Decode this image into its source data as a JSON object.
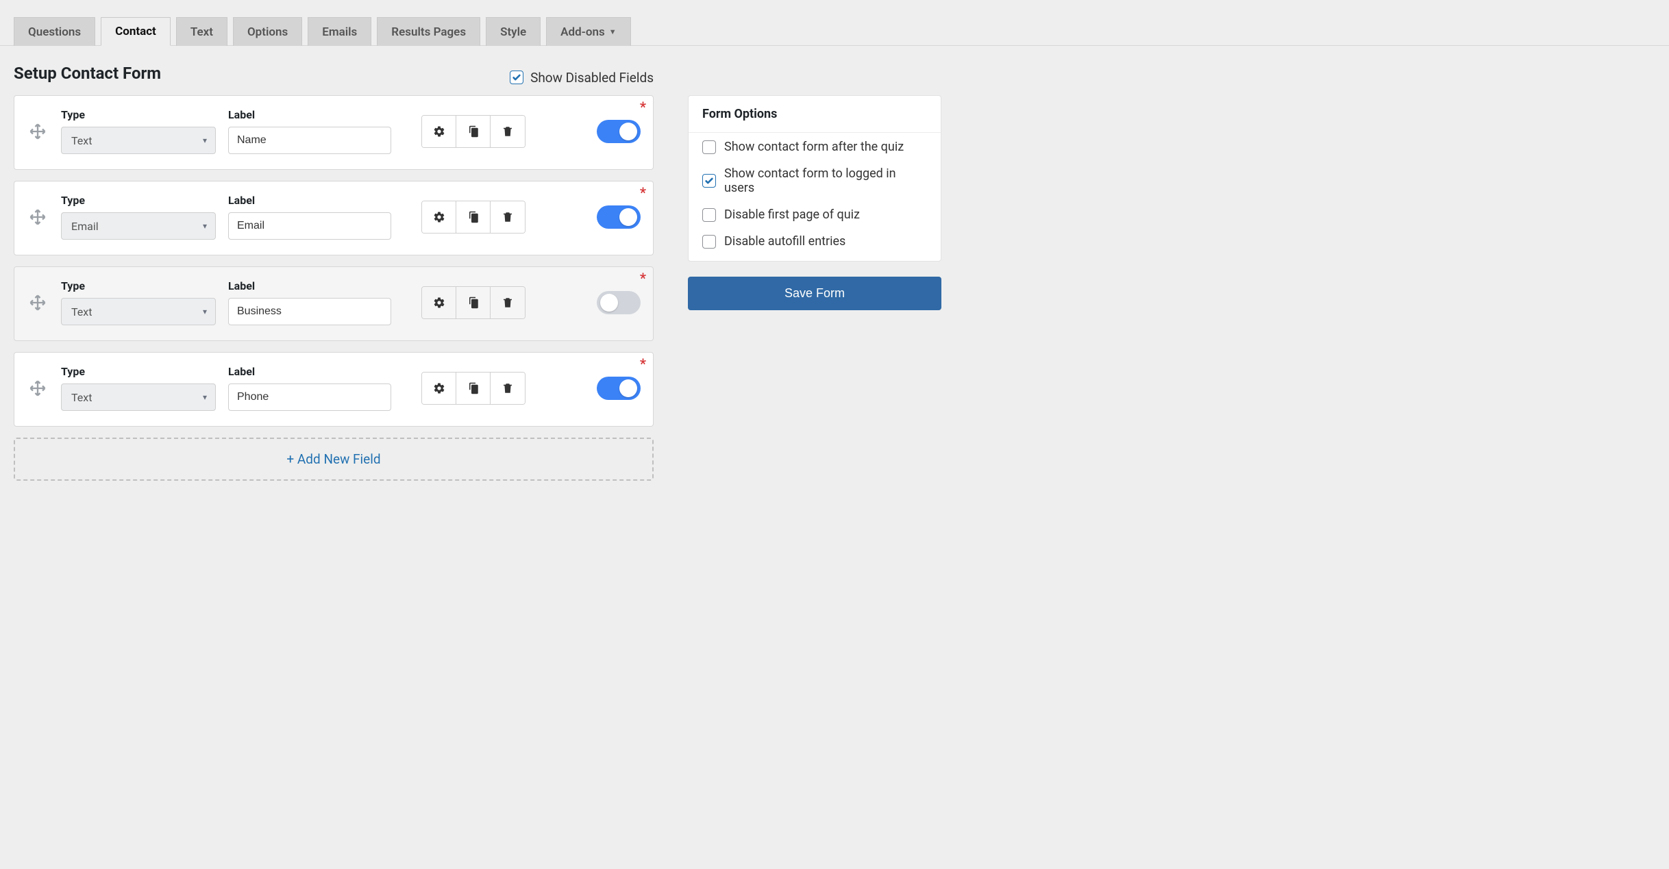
{
  "tabs": [
    {
      "label": "Questions"
    },
    {
      "label": "Contact"
    },
    {
      "label": "Text"
    },
    {
      "label": "Options"
    },
    {
      "label": "Emails"
    },
    {
      "label": "Results Pages"
    },
    {
      "label": "Style"
    },
    {
      "label": "Add-ons"
    }
  ],
  "active_tab_index": 1,
  "heading": "Setup Contact Form",
  "show_disabled_label": "Show Disabled Fields",
  "show_disabled_checked": true,
  "columns": {
    "type": "Type",
    "label": "Label"
  },
  "fields": [
    {
      "type": "Text",
      "label": "Name",
      "enabled": true,
      "required": true
    },
    {
      "type": "Email",
      "label": "Email",
      "enabled": true,
      "required": true
    },
    {
      "type": "Text",
      "label": "Business",
      "enabled": false,
      "required": true
    },
    {
      "type": "Text",
      "label": "Phone",
      "enabled": true,
      "required": true
    }
  ],
  "add_field_label": "+ Add New Field",
  "sidebar": {
    "title": "Form Options",
    "options": [
      {
        "label": "Show contact form after the quiz",
        "checked": false
      },
      {
        "label": "Show contact form to logged in users",
        "checked": true
      },
      {
        "label": "Disable first page of quiz",
        "checked": false
      },
      {
        "label": "Disable autofill entries",
        "checked": false
      }
    ],
    "save_label": "Save Form"
  }
}
